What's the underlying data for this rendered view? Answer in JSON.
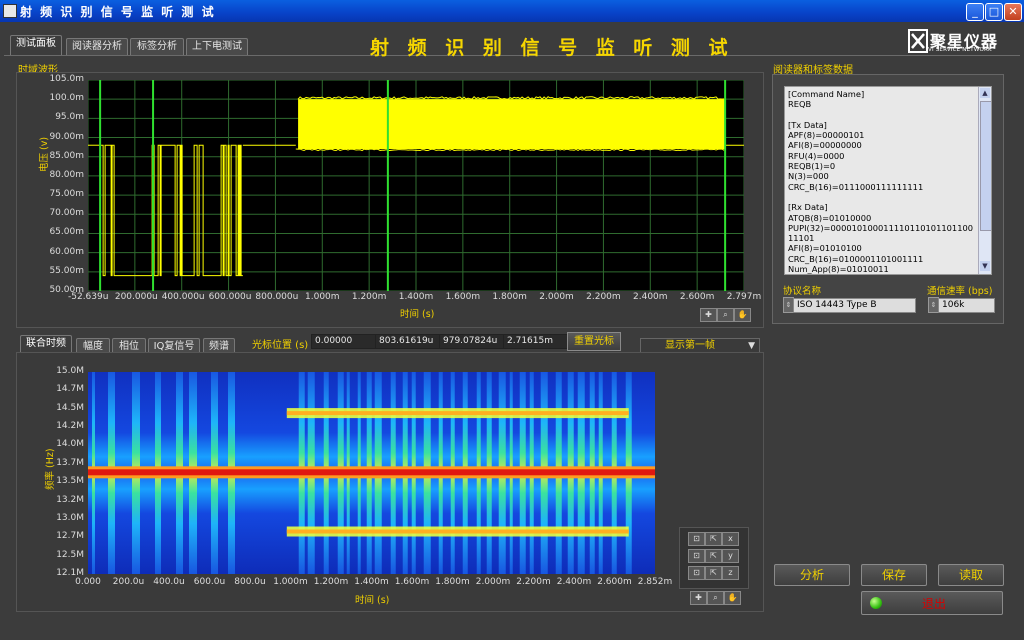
{
  "window": {
    "title": "射 频 识 别 信 号 监 听 测 试"
  },
  "tabs": [
    {
      "label": "测试面板"
    },
    {
      "label": "阅读器分析"
    },
    {
      "label": "标签分析"
    },
    {
      "label": "上下电测试"
    }
  ],
  "page_title": "射 频 识 别 信 号 监 听 测 试",
  "logo": {
    "name": "聚星仪器",
    "sub": "VI SERVICE NETWORK"
  },
  "time_chart": {
    "section": "时域波形",
    "ylabel": "电压 (v)",
    "xlabel": "时间 (s)",
    "yticks": [
      "105.0m",
      "100.0m",
      "95.0m",
      "90.00m",
      "85.00m",
      "80.00m",
      "75.00m",
      "70.00m",
      "65.00m",
      "60.00m",
      "55.00m",
      "50.00m"
    ],
    "xticks": [
      "-52.639u",
      "200.000u",
      "400.000u",
      "600.000u",
      "800.000u",
      "1.000m",
      "1.200m",
      "1.400m",
      "1.600m",
      "1.800m",
      "2.000m",
      "2.200m",
      "2.400m",
      "2.600m",
      "2.797m"
    ]
  },
  "chart_data": [
    {
      "type": "line",
      "title": "",
      "xlabel": "时间 (s)",
      "ylabel": "电压 (v)",
      "xlim": [
        -5.2639e-05,
        0.002797
      ],
      "ylim": [
        0.05,
        0.105
      ],
      "cursors_x": [
        0.0,
        0.00023,
        0.00125,
        0.002715
      ],
      "series": [
        {
          "color": "#ffff00",
          "segments": [
            {
              "x0": -5.2639e-05,
              "x1": 0.0,
              "y": 0.088
            },
            {
              "x0": 0.0,
              "x1": 0.00062,
              "y_low": 0.054,
              "y_high": 0.088,
              "mode": "pulsed"
            },
            {
              "x0": 0.00062,
              "x1": 0.00085,
              "y": 0.088
            },
            {
              "x0": 0.00085,
              "x1": 0.00086,
              "y": 0.087
            },
            {
              "x0": 0.00086,
              "x1": 0.002715,
              "y_low": 0.087,
              "y_high": 0.1,
              "mode": "carrier"
            },
            {
              "x0": 0.002715,
              "x1": 0.002797,
              "y": 0.088
            }
          ]
        }
      ]
    },
    {
      "type": "heatmap",
      "title": "",
      "xlabel": "时间 (s)",
      "ylabel": "频率 (Hz)",
      "xlim": [
        0.0,
        0.002852
      ],
      "ylim": [
        12.1,
        15.0
      ],
      "yunit": "MHz",
      "carrier_mhz": 13.56,
      "sidebands_mhz": [
        12.71,
        14.41
      ],
      "sideband_start": 0.001
    }
  ],
  "reader_panel": {
    "section": "阅读器和标签数据",
    "text_lines": [
      "[Command Name]",
      "REQB",
      "",
      "[Tx Data]",
      "APF(8)=00000101",
      "AFI(8)=00000000",
      "RFU(4)=0000",
      "REQB(1)=0",
      "N(3)=000",
      "CRC_B(16)=0111000111111111",
      "",
      "[Rx Data]",
      "ATQB(8)=01010000",
      "PUPI(32)=00001010001111011010110110011101",
      "AFI(8)=01010100",
      "CRC_B(16)=0100001101001111",
      "Num_App(8)=01010011"
    ],
    "protocol_label": "协议名称",
    "protocol_value": "ISO 14443 Type B",
    "rate_label": "通信速率 (bps)",
    "rate_value": "106k"
  },
  "spec_tabs": [
    {
      "label": "联合时频"
    },
    {
      "label": "幅度"
    },
    {
      "label": "相位"
    },
    {
      "label": "IQ复信号"
    },
    {
      "label": "频谱"
    }
  ],
  "cursor": {
    "label": "光标位置 (s)",
    "values": [
      "0.00000",
      "803.61619u",
      "979.07824u",
      "2.71615m"
    ],
    "reset_label": "重置光标",
    "frame_select": "显示第一帧"
  },
  "spec_chart": {
    "ylabel": "频率 (Hz)",
    "xlabel": "时间 (s)",
    "yticks": [
      "15.0M",
      "14.7M",
      "14.5M",
      "14.2M",
      "14.0M",
      "13.7M",
      "13.5M",
      "13.2M",
      "13.0M",
      "12.7M",
      "12.5M",
      "12.1M"
    ],
    "xticks": [
      "0.000",
      "200.0u",
      "400.0u",
      "600.0u",
      "800.0u",
      "1.000m",
      "1.200m",
      "1.400m",
      "1.600m",
      "1.800m",
      "2.000m",
      "2.200m",
      "2.400m",
      "2.600m",
      "2.852m"
    ]
  },
  "buttons": {
    "analyze": "分析",
    "save": "保存",
    "read": "读取",
    "exit": "退出"
  },
  "colors": {
    "accent": "#f0d000",
    "plot_bg": "#000000",
    "grid": "#2f6b2f",
    "cursor": "#2fe030",
    "trace": "#ffff00",
    "titlebar": "#0842c8",
    "exit_text": "#d80000"
  }
}
